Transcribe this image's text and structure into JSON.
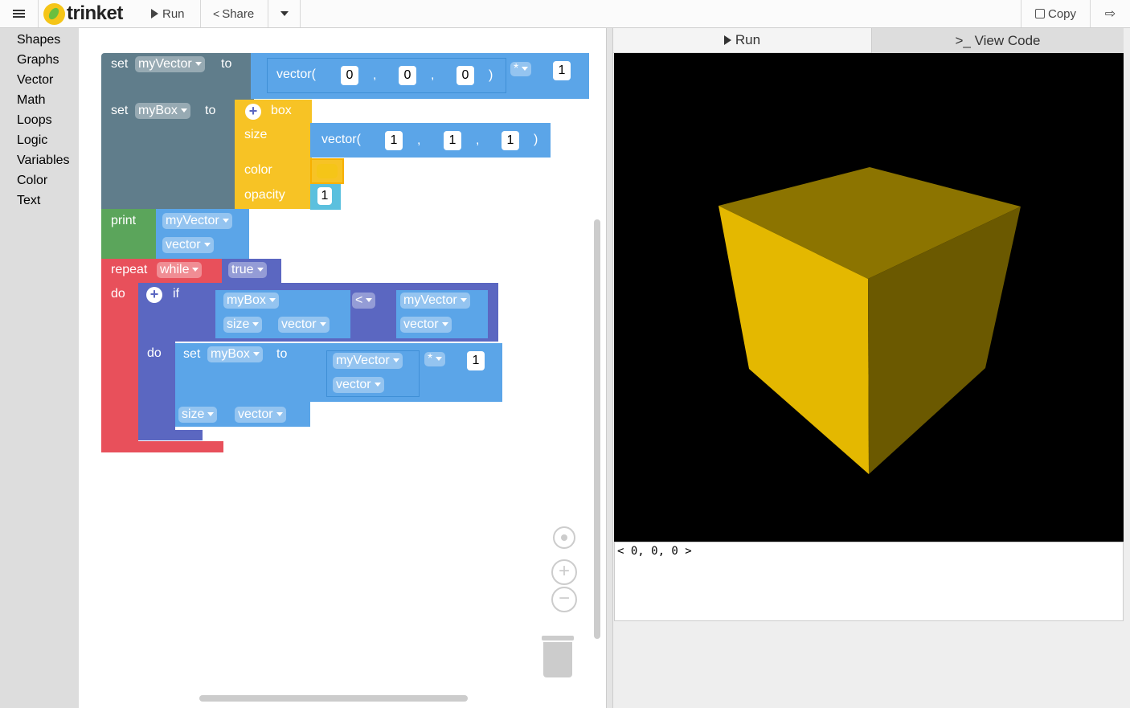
{
  "topbar": {
    "logo_text": "trinket",
    "run_label": "Run",
    "share_label": "Share",
    "copy_label": "Copy"
  },
  "toolbox": {
    "categories": [
      "Shapes",
      "Graphs",
      "Vector",
      "Math",
      "Loops",
      "Logic",
      "Variables",
      "Color",
      "Text"
    ]
  },
  "blocks": {
    "set1": {
      "kw_set": "set",
      "var": "myVector",
      "kw_to": "to",
      "vector_fn": "vector(",
      "x": "0",
      "y": "0",
      "z": "0",
      "close": ")",
      "comma": ",",
      "op": "*",
      "factor": "1"
    },
    "set2": {
      "kw_set": "set",
      "var": "myBox",
      "kw_to": "to",
      "shape": "box",
      "size_label": "size",
      "vector_fn": "vector(",
      "x": "1",
      "y": "1",
      "z": "1",
      "close": ")",
      "comma": ",",
      "color_label": "color",
      "color_value": "#f5c518",
      "opacity_label": "opacity",
      "opacity_value": "1"
    },
    "print": {
      "kw": "print",
      "var": "myVector",
      "attr": "vector"
    },
    "repeat": {
      "kw": "repeat",
      "mode": "while",
      "cond": "true",
      "do": "do"
    },
    "if": {
      "kw": "if",
      "left_var": "myBox",
      "left_attr1": "size",
      "left_attr2": "vector",
      "op": "<",
      "right_var": "myVector",
      "right_attr": "vector",
      "do": "do"
    },
    "set3": {
      "kw_set": "set",
      "var": "myBox",
      "kw_to": "to",
      "attr1": "size",
      "attr2": "vector",
      "value_var": "myVector",
      "value_attr": "vector",
      "op": "*",
      "factor": "1"
    }
  },
  "right": {
    "run_tab": "Run",
    "code_tab": ">_ View Code",
    "cube_color": "#e6b800",
    "console_output": "< 0, 0, 0 >"
  },
  "colors": {
    "accent": "#5ba5e8",
    "set_block": "#607d8b",
    "box_block": "#f7c325",
    "print_block": "#5ba55b",
    "loop_block": "#e8505b",
    "logic_block": "#5b67c1"
  }
}
